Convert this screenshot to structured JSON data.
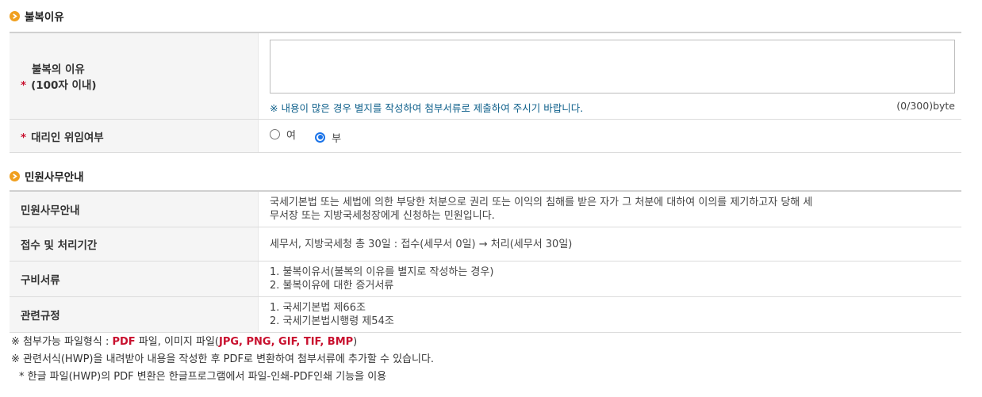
{
  "section1": {
    "title": "불복이유",
    "reason_label_line1": "불복의 이유",
    "reason_label_line2": "(100자 이내)",
    "required_mark": "*",
    "reason_value": "",
    "hint": "※ 내용이 많은 경우 별지를 작성하여 첨부서류로 제출하여 주시기 바랍니다.",
    "counter": "(0/300)byte",
    "proxy_label": "대리인 위임여부",
    "proxy_options": [
      {
        "label": "여",
        "selected": false
      },
      {
        "label": "부",
        "selected": true
      }
    ]
  },
  "section2": {
    "title": "민원사무안내",
    "rows": [
      {
        "label": "민원사무안내",
        "lines": [
          "국세기본법 또는 세법에 의한 부당한 처분으로 권리 또는 이익의 침해를 받은 자가 그 처분에 대하여 이의를 제기하고자 당해 세",
          "무서장 또는 지방국세청장에게 신청하는 민원입니다."
        ]
      },
      {
        "label": "접수 및 처리기간",
        "lines": [
          "세무서, 지방국세청 총 30일 : 접수(세무서 0일) → 처리(세무서 30일)"
        ]
      },
      {
        "label": "구비서류",
        "lines": [
          "1. 불복이유서(불복의 이유를 별지로 작성하는 경우)",
          "2. 불복이유에 대한 증거서류"
        ]
      },
      {
        "label": "관련규정",
        "lines": [
          "1. 국세기본법 제66조",
          "2. 국세기본법시행령 제54조"
        ]
      }
    ]
  },
  "notes": {
    "line1_prefix": "※ 첨부가능 파일형식 : ",
    "line1_pdf": "PDF",
    "line1_mid": " 파일, 이미지 파일(",
    "line1_formats": "JPG, PNG, GIF, TIF, BMP",
    "line1_suffix": ")",
    "line2": "※ 관련서식(HWP)을 내려받아 내용을 작성한 후 PDF로 변환하여 첨부서류에 추가할 수 있습니다.",
    "line3": "* 한글 파일(HWP)의 PDF 변환은 한글프로그램에서 파일-인쇄-PDF인쇄 기능을 이용"
  },
  "colors": {
    "accent": "#f0a020",
    "required": "#c8102e",
    "hint": "#0d5f8a",
    "radio_on": "#1a73e8"
  },
  "icons": {
    "section_bullet": "chevron-right-circle-icon"
  }
}
